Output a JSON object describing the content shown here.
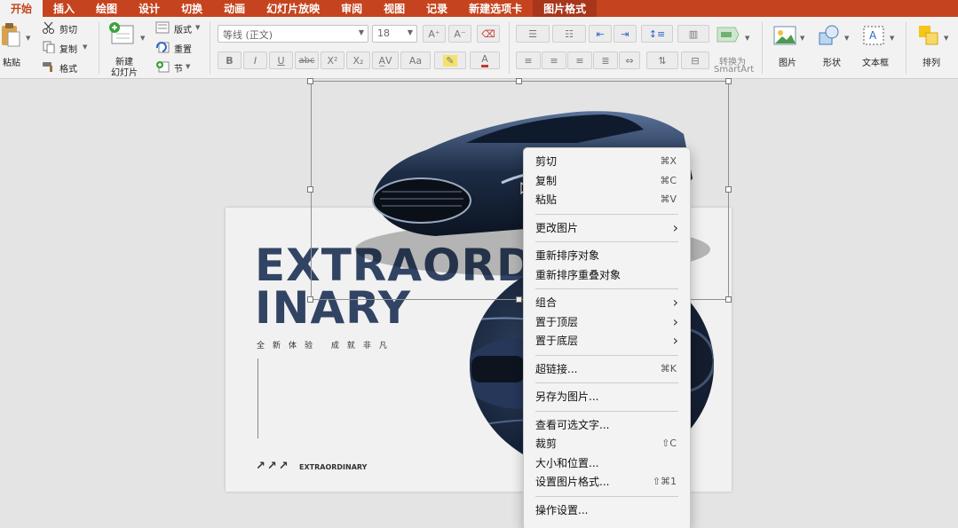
{
  "tabs": [
    {
      "label": "开始",
      "active": true
    },
    {
      "label": "插入"
    },
    {
      "label": "绘图"
    },
    {
      "label": "设计"
    },
    {
      "label": "切换"
    },
    {
      "label": "动画"
    },
    {
      "label": "幻灯片放映"
    },
    {
      "label": "审阅"
    },
    {
      "label": "视图"
    },
    {
      "label": "记录"
    },
    {
      "label": "新建选项卡"
    },
    {
      "label": "图片格式",
      "contextual": true
    }
  ],
  "ribbon": {
    "paste": "粘贴",
    "cut": "剪切",
    "copy": "复制",
    "format": "格式",
    "new_slide": "新建\n幻灯片",
    "new_slide_l1": "新建",
    "new_slide_l2": "幻灯片",
    "layout": "版式",
    "reset": "重置",
    "section": "节",
    "font_name": "等线 (正文)",
    "font_size": "18",
    "convert_smartart_l1": "转换为",
    "convert_smartart_l2": "SmartArt",
    "picture": "图片",
    "shape": "形状",
    "textbox": "文本框",
    "arrange": "排列"
  },
  "slide": {
    "headline_line1": "EXTRAORD",
    "headline_line2": "INARY",
    "subtitle": "全新体验  成就非凡",
    "arrows": "↗↗↗",
    "brand": "EXTRAORDINARY"
  },
  "context_menu": {
    "groups": [
      [
        {
          "label": "剪切",
          "shortcut": "⌘X"
        },
        {
          "label": "复制",
          "shortcut": "⌘C"
        },
        {
          "label": "粘贴",
          "shortcut": "⌘V"
        }
      ],
      [
        {
          "label": "更改图片",
          "submenu": true
        }
      ],
      [
        {
          "label": "重新排序对象"
        },
        {
          "label": "重新排序重叠对象"
        }
      ],
      [
        {
          "label": "组合",
          "submenu": true
        },
        {
          "label": "置于顶层",
          "submenu": true
        },
        {
          "label": "置于底层",
          "submenu": true
        }
      ],
      [
        {
          "label": "超链接...",
          "shortcut": "⌘K"
        }
      ],
      [
        {
          "label": "另存为图片..."
        }
      ],
      [
        {
          "label": "查看可选文字..."
        },
        {
          "label": "裁剪",
          "shortcut": "⇧C"
        },
        {
          "label": "大小和位置..."
        },
        {
          "label": "设置图片格式...",
          "shortcut": "⇧⌘1"
        }
      ],
      [
        {
          "label": "操作设置..."
        }
      ]
    ]
  },
  "colors": {
    "ribbon_accent": "#c5441f",
    "headline": "#324463",
    "car_body": "#1c2b44"
  }
}
